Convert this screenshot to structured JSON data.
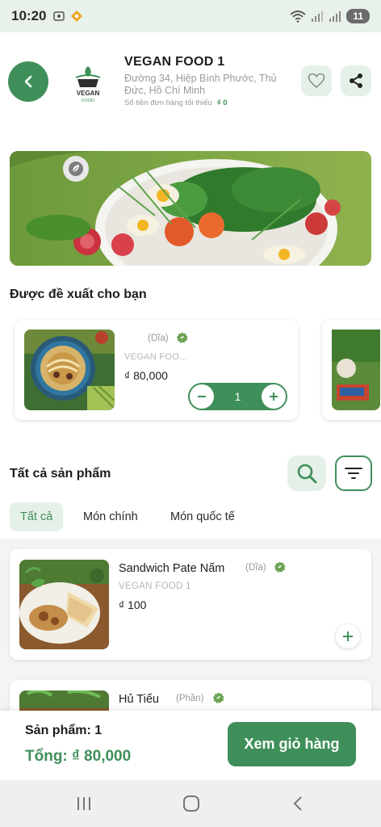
{
  "status_bar": {
    "time": "10:20",
    "battery": "11"
  },
  "header": {
    "shop_name": "VEGAN FOOD 1",
    "address": "Đường 34, Hiệp Bình Phước, Thủ Đức, Hồ Chí Minh",
    "min_order_label": "Số tiền đơn hàng tối thiểu",
    "min_order_value": "₫ 0",
    "logo_text": "VEGAN",
    "logo_subtext": "FOOD"
  },
  "recommended": {
    "title": "Được đề xuất cho bạn",
    "items": [
      {
        "name": "",
        "unit": "(Dĩa)",
        "shop": "VEGAN FOO...",
        "price": "₫ 80,000",
        "quantity": "1"
      }
    ]
  },
  "products": {
    "title": "Tất cả sản phẩm",
    "tabs": [
      {
        "label": "Tất cả",
        "active": true
      },
      {
        "label": "Món chính",
        "active": false
      },
      {
        "label": "Món quốc tế",
        "active": false
      }
    ],
    "items": [
      {
        "name": "Sandwich Pate Nấm",
        "unit": "(Dĩa)",
        "shop": "VEGAN FOOD 1",
        "price": "₫ 100"
      },
      {
        "name": "Hủ Tiếu",
        "unit": "(Phần)"
      }
    ]
  },
  "cart": {
    "count_label": "Sản phẩm: 1",
    "total_label": "Tổng: ₫ 80,000",
    "button_label": "Xem giỏ hàng"
  },
  "colors": {
    "primary": "#3f8f5a",
    "primary_light": "#e5f1e8"
  },
  "icons": [
    "back-arrow-icon",
    "heart-icon",
    "share-icon",
    "leaf-icon",
    "vegan-icon",
    "search-icon",
    "filter-icon",
    "plus-icon",
    "minus-icon",
    "recent-apps-icon",
    "home-icon",
    "nav-back-icon"
  ]
}
